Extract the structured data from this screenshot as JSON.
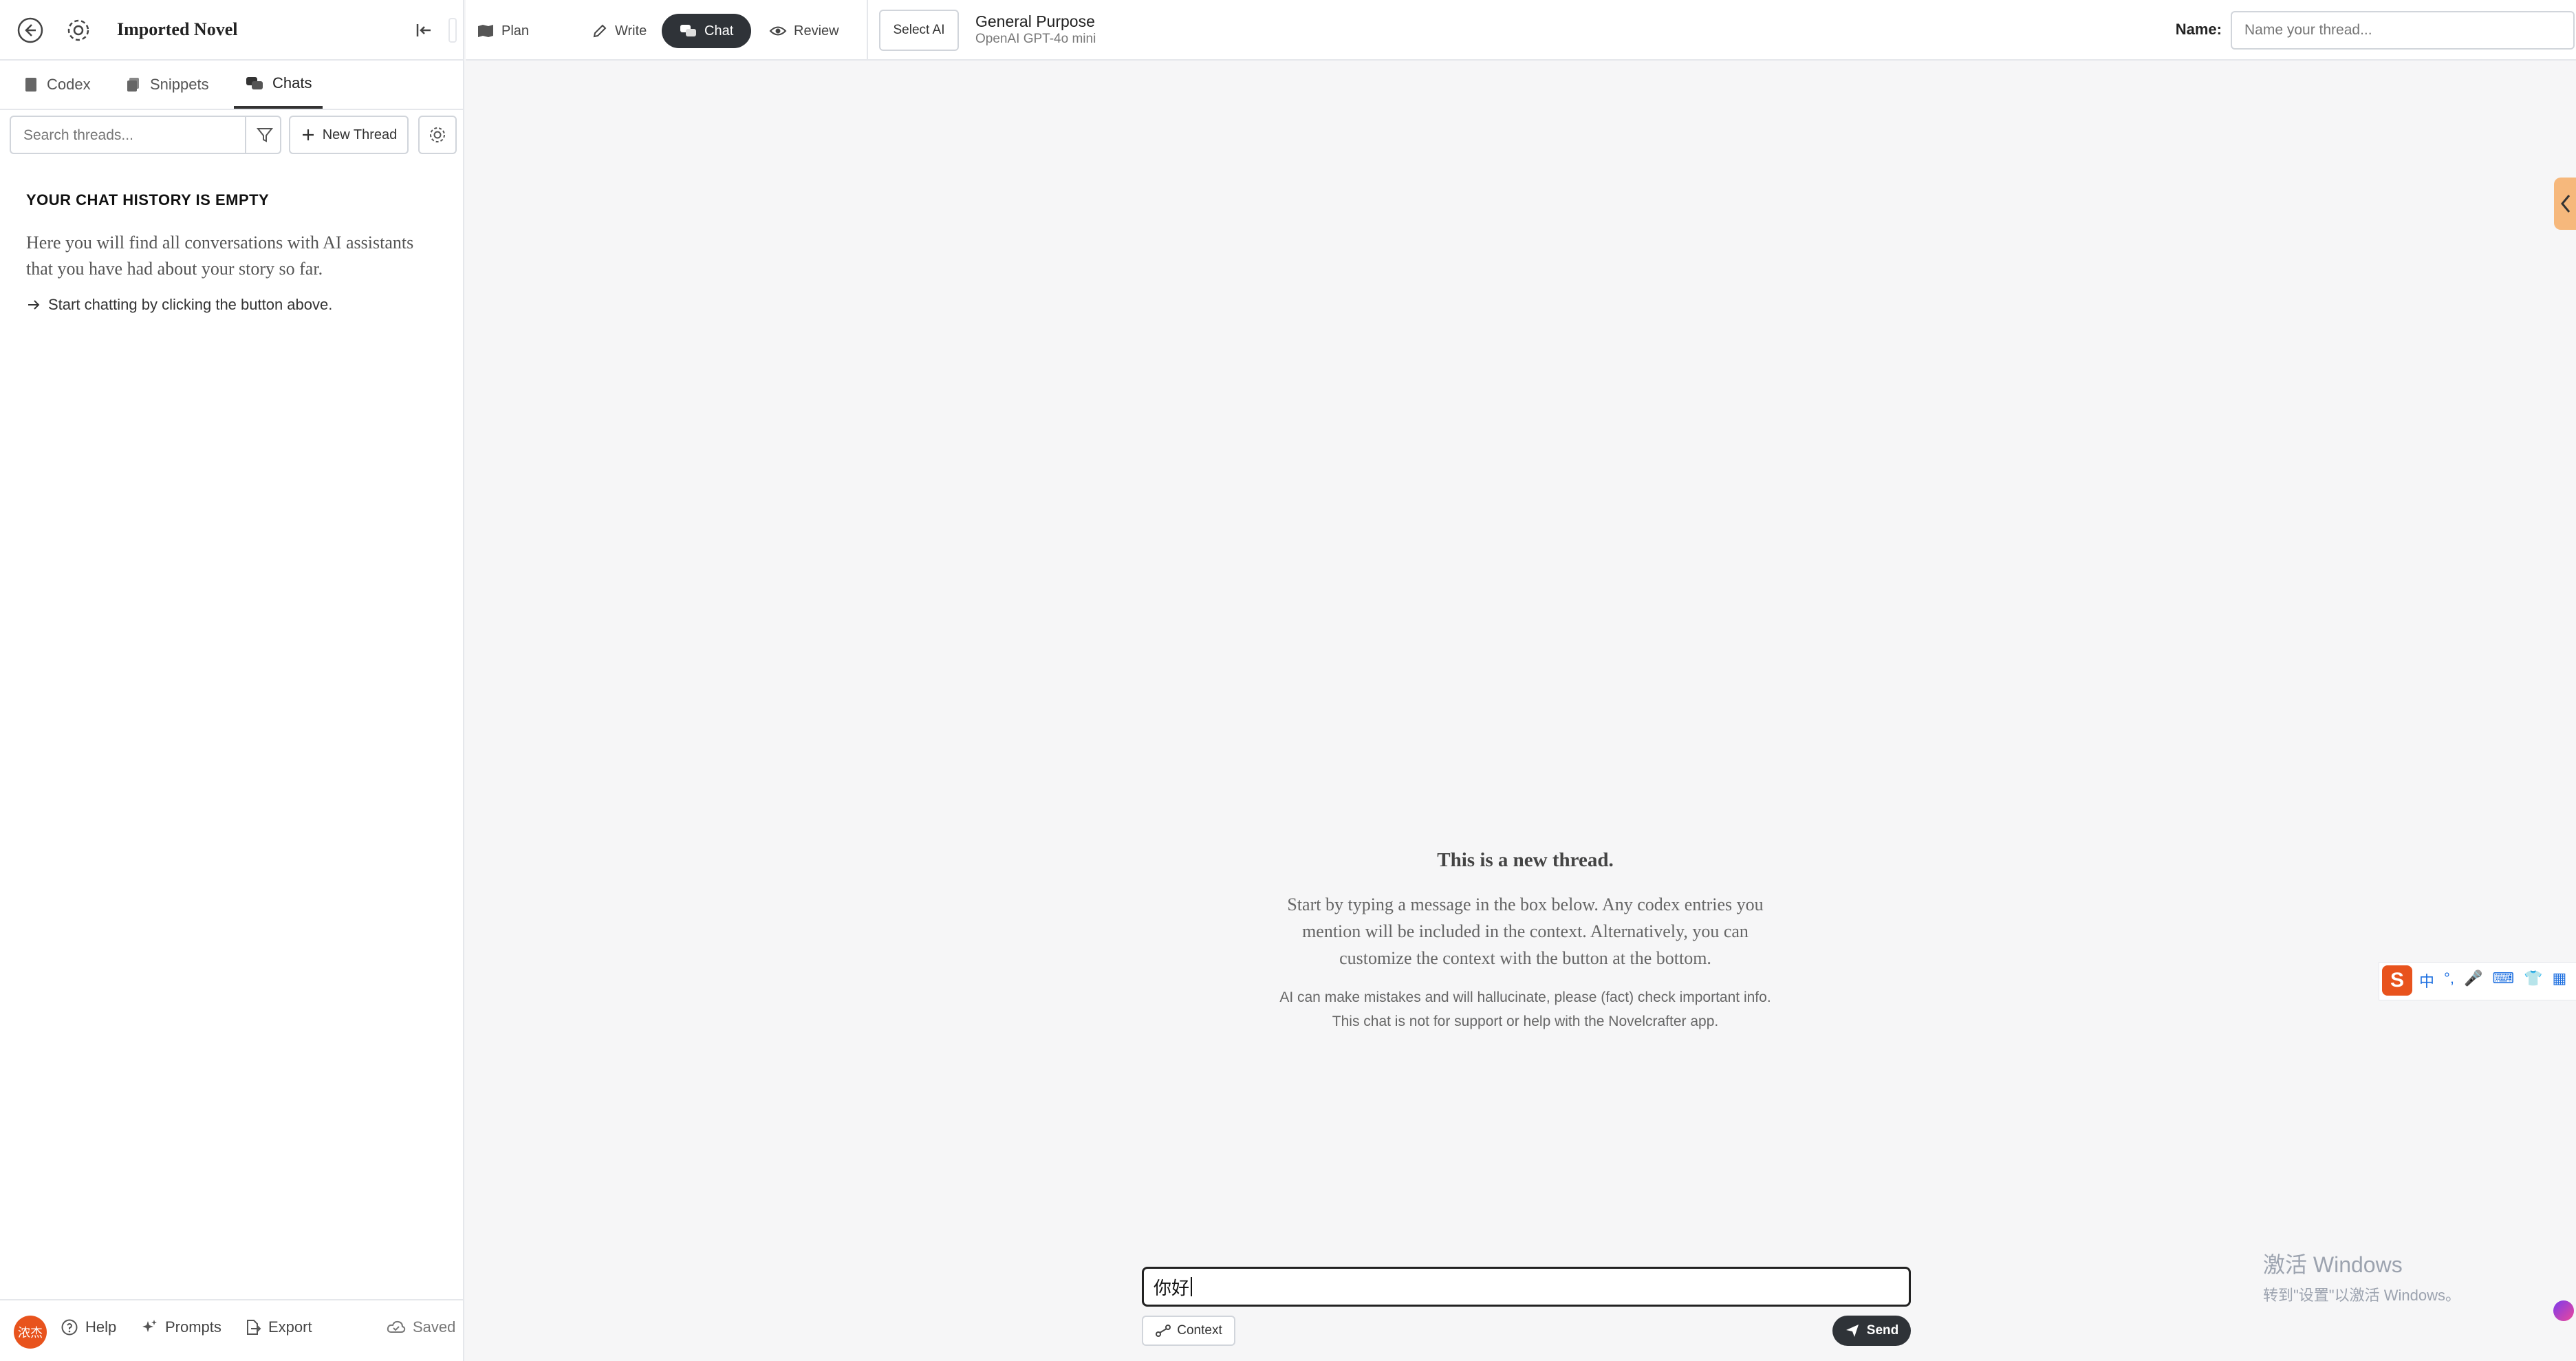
{
  "sidebar": {
    "title": "Imported Novel",
    "tabs": [
      {
        "label": "Codex",
        "icon": "book-icon"
      },
      {
        "label": "Snippets",
        "icon": "snippets-icon"
      },
      {
        "label": "Chats",
        "icon": "chats-icon",
        "active": true
      }
    ],
    "search_placeholder": "Search threads...",
    "new_thread_label": "New Thread",
    "empty": {
      "title": "YOUR CHAT HISTORY IS EMPTY",
      "description": "Here you will find all conversations with AI assistants that you have had about your story so far.",
      "hint": "Start chatting by clicking the button above."
    },
    "footer": {
      "avatar_text": "浓杰",
      "help": "Help",
      "prompts": "Prompts",
      "export": "Export",
      "saved": "Saved"
    }
  },
  "topbar": {
    "modes": [
      {
        "label": "Plan",
        "icon": "map-icon"
      },
      {
        "label": "Write",
        "icon": "pencil-icon"
      },
      {
        "label": "Chat",
        "icon": "chat-icon",
        "active": true
      },
      {
        "label": "Review",
        "icon": "eye-icon"
      }
    ],
    "select_ai_label": "Select AI",
    "ai_name": "General Purpose",
    "ai_model": "OpenAI GPT-4o mini",
    "name_label": "Name:",
    "name_placeholder": "Name your thread..."
  },
  "thread": {
    "title": "This is a new thread.",
    "body": "Start by typing a message in the box below. Any codex entries you mention will be included in the context. Alternatively, you can customize the context with the button at the bottom.",
    "warning": "AI can make mistakes and will hallucinate, please (fact) check important info. This chat is not for support or help with the Novelcrafter app."
  },
  "composer": {
    "input_value": "你好",
    "context_label": "Context",
    "send_label": "Send"
  },
  "ime": {
    "logo": "S",
    "items": [
      "中",
      "°,",
      "🎤",
      "⌨",
      "👕",
      "▦"
    ]
  },
  "watermark": {
    "line1": "激活 Windows",
    "line2": "转到\"设置\"以激活 Windows。"
  },
  "colors": {
    "accent_dark": "#2f3338",
    "avatar": "#e8531d",
    "side_tab": "#f6b87c"
  }
}
